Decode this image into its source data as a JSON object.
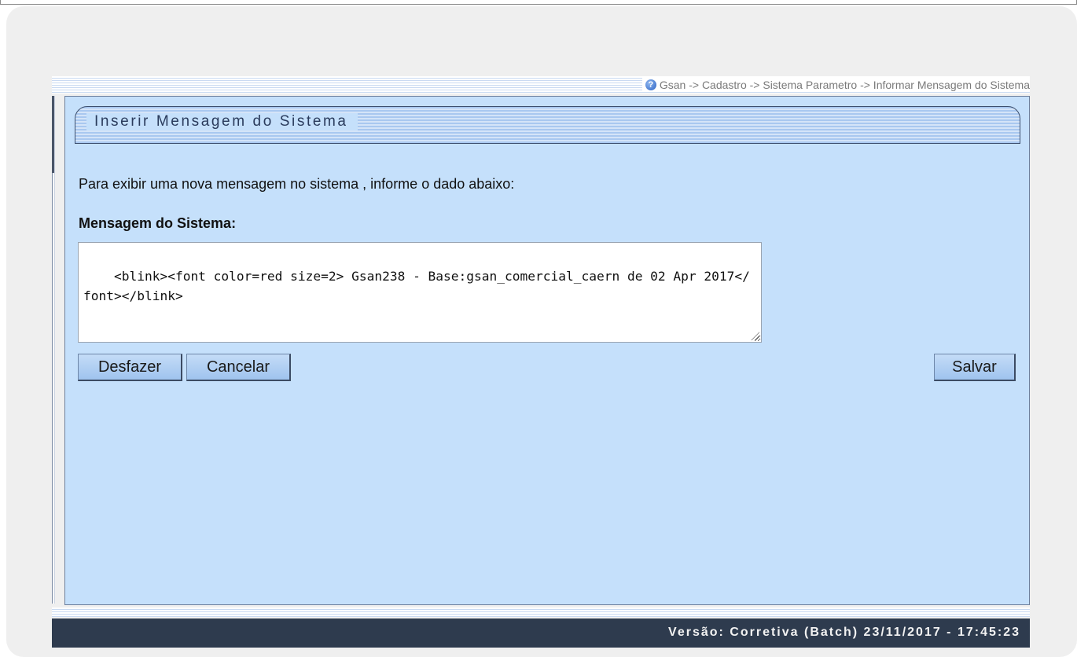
{
  "breadcrumb": {
    "help_icon": "help-question-icon",
    "text": "Gsan -> Cadastro -> Sistema Parametro -> Informar Mensagem do Sistema"
  },
  "panel": {
    "title": "Inserir Mensagem do Sistema",
    "instruction": "Para exibir uma nova mensagem no sistema , informe o dado abaixo:",
    "field_label": "Mensagem do Sistema:",
    "message_value": "<blink><font color=red size=2> Gsan238 - Base:gsan_comercial_caern de 02 Apr 2017</font></blink>"
  },
  "buttons": {
    "undo": "Desfazer",
    "cancel": "Cancelar",
    "save": "Salvar"
  },
  "footer": {
    "version": "Versão: Corretiva (Batch) 23/11/2017 - 17:45:23"
  },
  "colors": {
    "panel_bg": "#c5e0fb",
    "footer_bg": "#2e3b4e",
    "card_bg": "#efefef"
  }
}
